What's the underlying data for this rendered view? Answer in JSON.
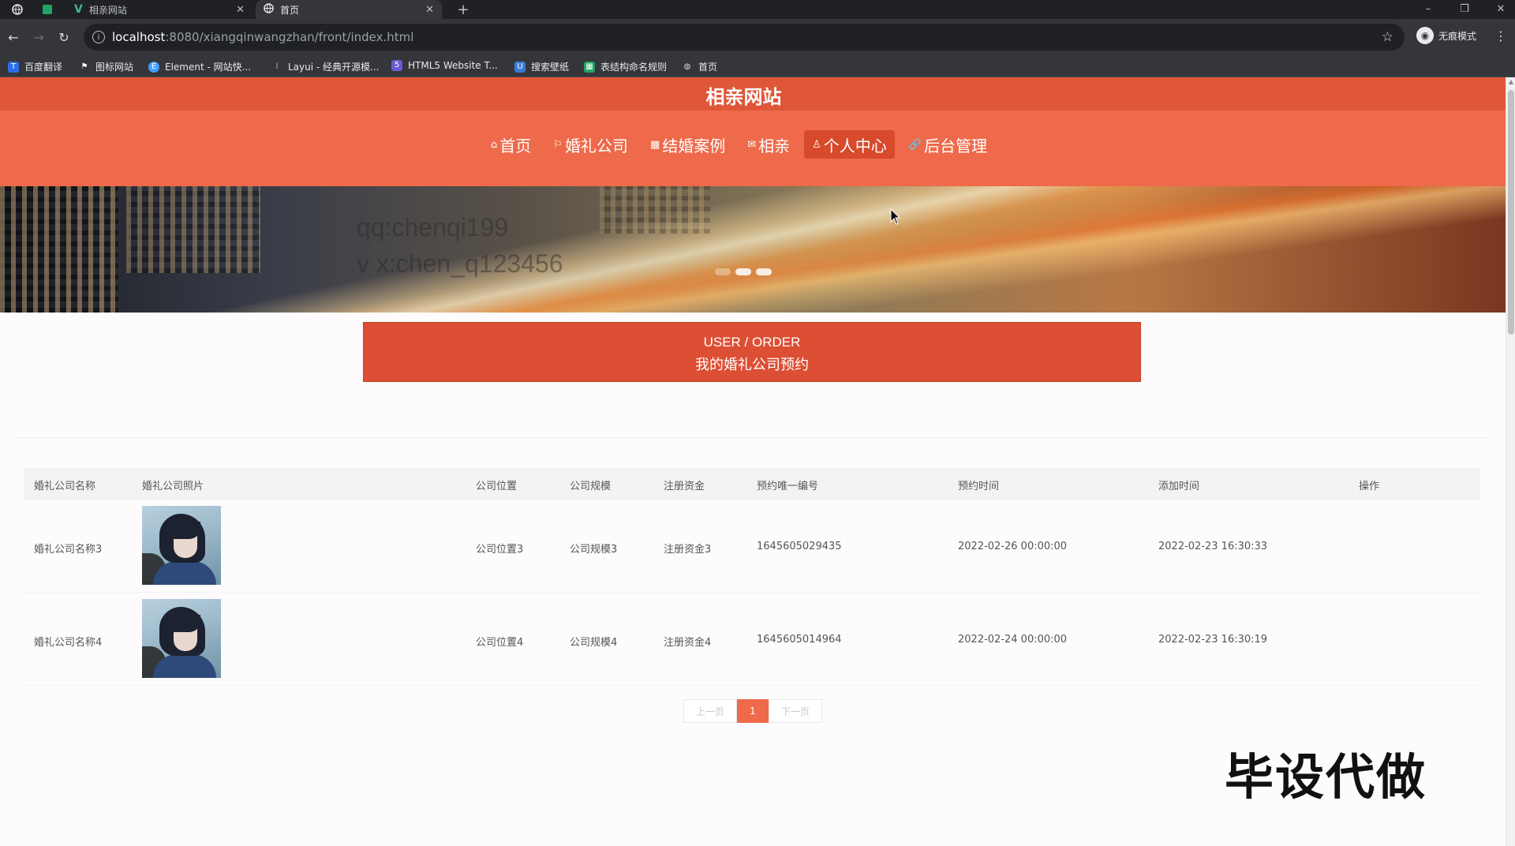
{
  "browser": {
    "tabs": [
      {
        "title": "相亲网站",
        "close": "✕"
      },
      {
        "title": "首页",
        "close": "✕"
      }
    ],
    "new_tab": "+",
    "window": {
      "minimize": "–",
      "restore": "❐",
      "close": "✕"
    },
    "url": {
      "host": "localhost",
      "rest": ":8080/xiangqinwangzhan/front/index.html"
    },
    "profile_label": "无痕模式",
    "bookmarks": [
      {
        "label": "百度翻译",
        "icon": "baidu-translate-icon",
        "color": "#2b6de5"
      },
      {
        "label": "图标网站",
        "icon": "flag-icon",
        "color": "#ffffff"
      },
      {
        "label": "Element - 网站快...",
        "icon": "element-icon",
        "color": "#409eff"
      },
      {
        "label": "Layui - 经典开源模...",
        "icon": "layui-icon",
        "color": "#bbbbbb"
      },
      {
        "label": "HTML5 Website T...",
        "icon": "html5-icon",
        "color": "#6b5bd2"
      },
      {
        "label": "搜索壁纸",
        "icon": "wallpaper-icon",
        "color": "#3a7bd5"
      },
      {
        "label": "表结构命名规则",
        "icon": "sheet-icon",
        "color": "#1fa463"
      },
      {
        "label": "首页",
        "icon": "globe-icon",
        "color": "#dddddd"
      }
    ]
  },
  "site": {
    "title": "相亲网站",
    "nav": [
      {
        "label": "首页",
        "icon": "home-icon",
        "glyph": "⌂"
      },
      {
        "label": "婚礼公司",
        "icon": "flag-icon",
        "glyph": "⚐"
      },
      {
        "label": "结婚案例",
        "icon": "grid-icon",
        "glyph": "▦"
      },
      {
        "label": "相亲",
        "icon": "mail-icon",
        "glyph": "✉"
      },
      {
        "label": "个人中心",
        "icon": "user-icon",
        "glyph": "♙"
      },
      {
        "label": "后台管理",
        "icon": "link-icon",
        "glyph": "🔗"
      }
    ],
    "active_nav": "个人中心",
    "colors": {
      "primary": "#ee6a4a",
      "header_top": "#e05638",
      "title_box": "#dc4f34"
    }
  },
  "banner": {
    "text_line1": "qq:chenqi199",
    "text_line2": "v x:chen_q123456",
    "slides": 3,
    "active_slide": 2
  },
  "section": {
    "title_en": "USER / ORDER",
    "title_cn": "我的婚礼公司预约"
  },
  "table": {
    "headers": [
      "婚礼公司名称",
      "婚礼公司照片",
      "公司位置",
      "公司规模",
      "注册资金",
      "预约唯一编号",
      "预约时间",
      "添加时间",
      "操作"
    ],
    "rows": [
      {
        "name": "婚礼公司名称3",
        "location": "公司位置3",
        "scale": "公司规模3",
        "capital": "注册资金3",
        "order_no": "1645605029435",
        "booking_time": "2022-02-26 00:00:00",
        "add_time": "2022-02-23 16:30:33"
      },
      {
        "name": "婚礼公司名称4",
        "location": "公司位置4",
        "scale": "公司规模4",
        "capital": "注册资金4",
        "order_no": "1645605014964",
        "booking_time": "2022-02-24 00:00:00",
        "add_time": "2022-02-23 16:30:19"
      }
    ]
  },
  "pager": {
    "prev": "上一页",
    "current": "1",
    "next": "下一页"
  },
  "watermark": "毕设代做"
}
